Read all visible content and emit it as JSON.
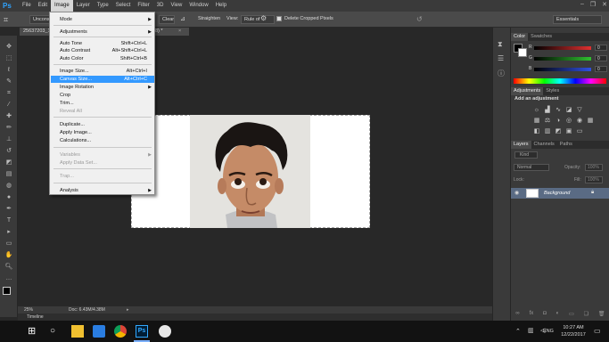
{
  "app": {
    "logo": "Ps"
  },
  "menubar": {
    "items": [
      "File",
      "Edit",
      "Image",
      "Layer",
      "Type",
      "Select",
      "Filter",
      "3D",
      "View",
      "Window",
      "Help"
    ],
    "active": "Image"
  },
  "window_controls": {
    "minimize": "–",
    "maximize": "❐",
    "close": "✕"
  },
  "options": {
    "ratio": "Unconstrained",
    "clear": "Clear",
    "straighten_label": "Straighten",
    "view_label": "View:",
    "view_value": "Rule of Thirds",
    "delete_cropped": "Delete Cropped Pixels",
    "workspace": "Essentials"
  },
  "document": {
    "tab": "25637203_1",
    "tab_suffix": "8) *"
  },
  "image_menu": {
    "items": [
      {
        "label": "Mode",
        "shortcut": "",
        "submenu": true,
        "disabled": false
      },
      {
        "label": "Adjustments",
        "shortcut": "",
        "submenu": true,
        "disabled": false
      },
      {
        "label": "Auto Tone",
        "shortcut": "Shift+Ctrl+L",
        "submenu": false,
        "disabled": false
      },
      {
        "label": "Auto Contrast",
        "shortcut": "Alt+Shift+Ctrl+L",
        "submenu": false,
        "disabled": false
      },
      {
        "label": "Auto Color",
        "shortcut": "Shift+Ctrl+B",
        "submenu": false,
        "disabled": false
      },
      {
        "label": "Image Size...",
        "shortcut": "Alt+Ctrl+I",
        "submenu": false,
        "disabled": false
      },
      {
        "label": "Canvas Size...",
        "shortcut": "Alt+Ctrl+C",
        "submenu": false,
        "disabled": false,
        "highlight": true
      },
      {
        "label": "Image Rotation",
        "shortcut": "",
        "submenu": true,
        "disabled": false
      },
      {
        "label": "Crop",
        "shortcut": "",
        "submenu": false,
        "disabled": false
      },
      {
        "label": "Trim...",
        "shortcut": "",
        "submenu": false,
        "disabled": false
      },
      {
        "label": "Reveal All",
        "shortcut": "",
        "submenu": false,
        "disabled": true
      },
      {
        "label": "Duplicate...",
        "shortcut": "",
        "submenu": false,
        "disabled": false
      },
      {
        "label": "Apply Image...",
        "shortcut": "",
        "submenu": false,
        "disabled": false
      },
      {
        "label": "Calculations...",
        "shortcut": "",
        "submenu": false,
        "disabled": false
      },
      {
        "label": "Variables",
        "shortcut": "",
        "submenu": true,
        "disabled": true
      },
      {
        "label": "Apply Data Set...",
        "shortcut": "",
        "submenu": false,
        "disabled": true
      },
      {
        "label": "Trap...",
        "shortcut": "",
        "submenu": false,
        "disabled": true
      },
      {
        "label": "Analysis",
        "shortcut": "",
        "submenu": true,
        "disabled": false
      }
    ]
  },
  "status": {
    "zoom": "25%",
    "doc": "Doc: 6.43M/4.38M"
  },
  "timeline": {
    "label": "Timeline"
  },
  "color_panel": {
    "tabs": [
      "Color",
      "Swatches"
    ],
    "channels": [
      {
        "label": "R",
        "value": "0",
        "color": "#e03030"
      },
      {
        "label": "G",
        "value": "0",
        "color": "#30c030"
      },
      {
        "label": "B",
        "value": "0",
        "color": "#3050e0"
      }
    ]
  },
  "adjustments_panel": {
    "tabs": [
      "Adjustments",
      "Styles"
    ],
    "heading": "Add an adjustment"
  },
  "layers_panel": {
    "tabs": [
      "Layers",
      "Channels",
      "Paths"
    ],
    "kind": "Kind",
    "blend": "Normal",
    "opacity_label": "Opacity:",
    "opacity": "100%",
    "lock_label": "Lock:",
    "fill_label": "Fill:",
    "fill": "100%",
    "layer_name": "Background"
  },
  "taskbar": {
    "lang": "ENG",
    "time": "10:27 AM",
    "date": "12/22/2017"
  }
}
